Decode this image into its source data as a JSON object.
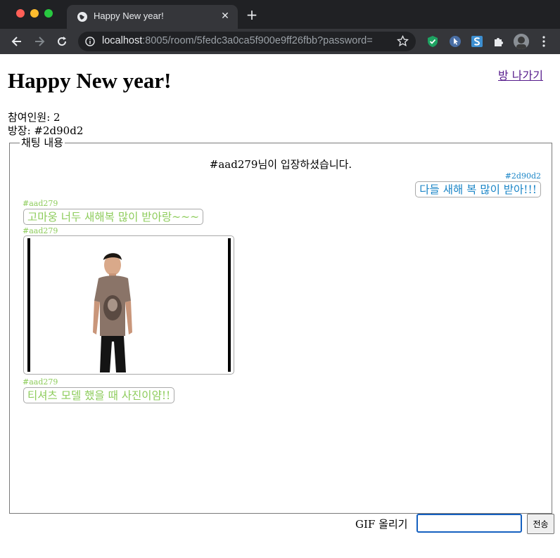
{
  "browser": {
    "tab_title": "Happy New year!",
    "url_host": "localhost",
    "url_rest": ":8005/room/5fedc3a0ca5f900e9ff26fbb?password=",
    "colors": {
      "frame": "#202124",
      "toolbar": "#35363a"
    }
  },
  "room": {
    "title": "Happy New year!",
    "leave_label": "방 나가기",
    "participants": "참여인원: 2",
    "host": "방장: #2d90d2"
  },
  "chat": {
    "legend": "채팅 내용",
    "system_message": "#aad279님이 입장하셨습니다.",
    "messages": [
      {
        "sender": "#2d90d2",
        "text": "다들 새해 복 많이 받아!!!",
        "mine": true
      },
      {
        "sender": "#aad279",
        "text": "고마웅 너두 새해복 많이 받아랑~~~",
        "mine": false
      },
      {
        "sender": "#aad279",
        "type": "gif",
        "mine": false
      },
      {
        "sender": "#aad279",
        "text": "티셔츠 모델 했을 때 사진이얌!!",
        "mine": false
      }
    ],
    "colors": {
      "mine": "#1a85c7",
      "other": "#8dcc5b"
    }
  },
  "composer": {
    "gif_label": "GIF 올리기",
    "input_value": "",
    "send_label": "전송"
  }
}
